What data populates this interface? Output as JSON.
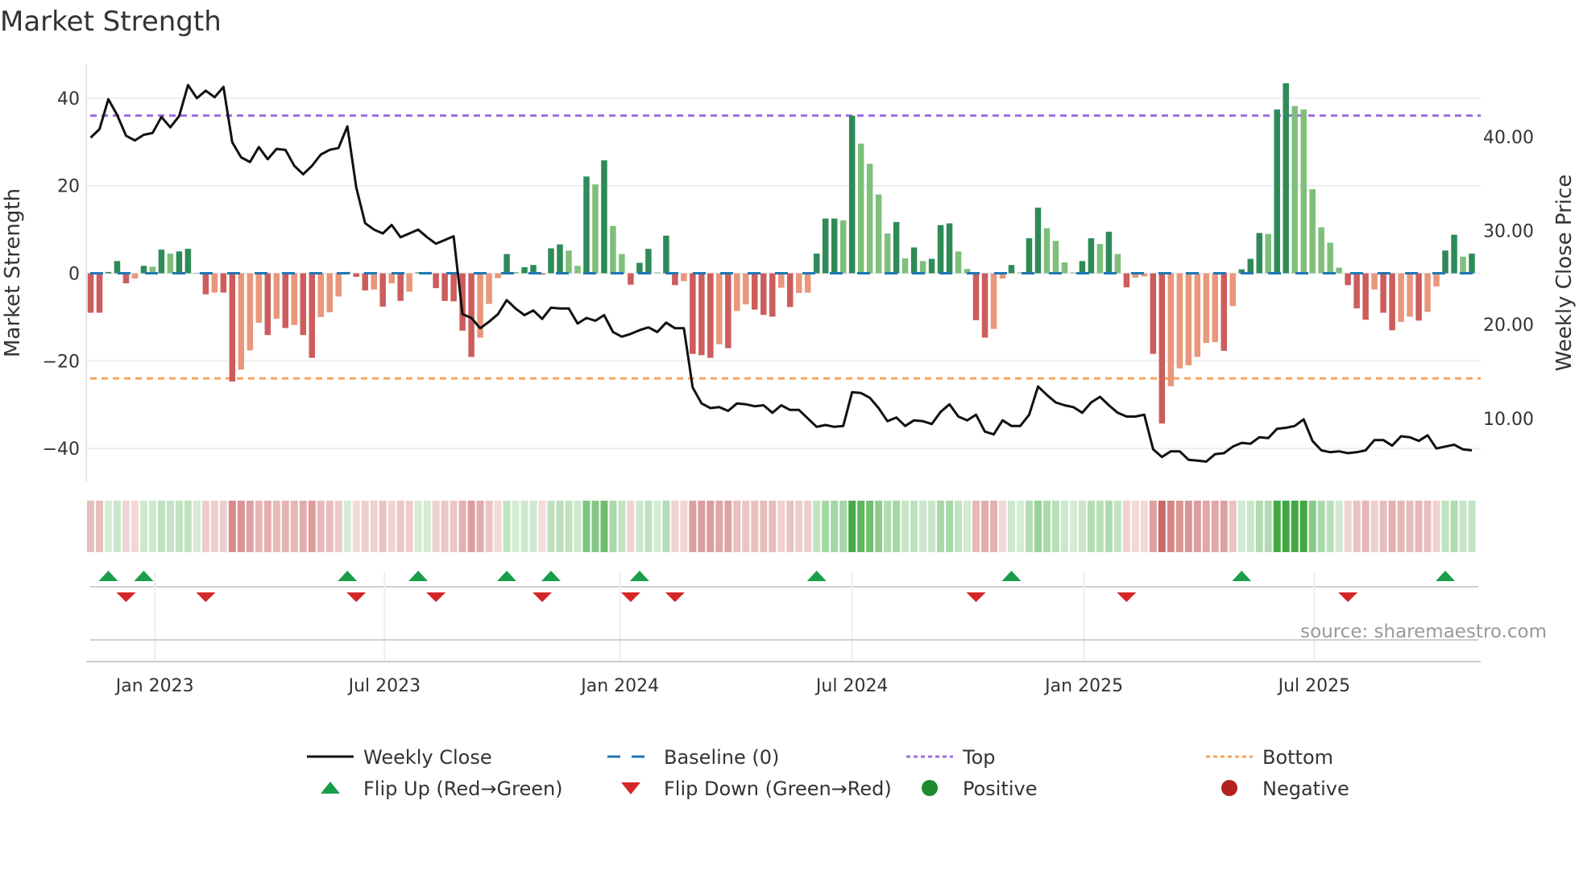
{
  "chart_data": {
    "type": "bar",
    "title": "Market Strength",
    "ylabel": "Market Strength",
    "y2label": "Weekly Close Price",
    "ylim": [
      -47.5,
      47.7
    ],
    "y2lim": [
      3.3,
      47.7
    ],
    "xlim": [
      -0.5,
      157
    ],
    "grid": true,
    "legend_position": "bottom",
    "y_ticks": [
      40,
      20,
      0,
      -20,
      -40
    ],
    "y_tick_labels": [
      "40",
      "20",
      "0",
      "−20",
      "−40"
    ],
    "y2_ticks": [
      40,
      30,
      20,
      10
    ],
    "y2_tick_labels": [
      "40.00",
      "30.00",
      "20.00",
      "10.00"
    ],
    "x_ticks_week_index": [
      7.25,
      33.2,
      59.8,
      86,
      112.2,
      138.2
    ],
    "x_tick_labels": [
      "Jan 2023",
      "Jul 2023",
      "Jan 2024",
      "Jul 2024",
      "Jan 2025",
      "Jul 2025"
    ],
    "top_level": 36,
    "bottom_level": -24,
    "baseline": 0,
    "strength": [
      -9,
      -9,
      0.3,
      2.8,
      -2.3,
      -1.2,
      1.7,
      1.5,
      5.4,
      4.5,
      5,
      5.6,
      0,
      -4.8,
      -4.4,
      -4.4,
      -24.7,
      -22,
      -17.6,
      -11.3,
      -14.1,
      -10.4,
      -12.5,
      -11.8,
      -14.1,
      -19.3,
      -10,
      -8.9,
      -5.3,
      0.3,
      -0.8,
      -3.9,
      -3.7,
      -7.6,
      -2.3,
      -6.3,
      -4.2,
      0.2,
      0.3,
      -3.4,
      -6.3,
      -6.4,
      -13.1,
      -19.1,
      -14.7,
      -7,
      -1.1,
      4.4,
      0.3,
      1.4,
      1.9,
      -0.3,
      5.7,
      6.6,
      5.2,
      1.7,
      22.1,
      20.3,
      25.8,
      10.8,
      4.4,
      -2.6,
      2.4,
      5.6,
      0.2,
      8.6,
      -2.7,
      -1.8,
      -18.4,
      -18.7,
      -19.3,
      -16.2,
      -17.1,
      -8.6,
      -7.1,
      -8.3,
      -9.5,
      -9.9,
      -3.3,
      -7.7,
      -4.5,
      -4.4,
      4.5,
      12.5,
      12.5,
      12.1,
      36,
      29.6,
      25,
      18,
      9.1,
      11.7,
      3.4,
      5.9,
      2.8,
      3.3,
      11,
      11.4,
      5,
      1,
      -10.7,
      -14.7,
      -12.7,
      -1.2,
      1.9,
      0.2,
      8,
      15,
      10.3,
      7.4,
      2.5,
      0.2,
      2.8,
      8,
      6.7,
      9.5,
      4.4,
      -3.2,
      -1,
      -0.7,
      -18.4,
      -34.3,
      -25.8,
      -21.7,
      -21,
      -19.1,
      -15.9,
      -15.7,
      -17.7,
      -7.5,
      0.9,
      3.3,
      9.2,
      9,
      37.4,
      43.4,
      38.2,
      37.4,
      19.2,
      10.5,
      7,
      1.3,
      -2.7,
      -8,
      -10.6,
      -3.7,
      -9,
      -13,
      -11.1,
      -9.9,
      -10.8,
      -8.8,
      -3,
      5.2,
      8.8,
      3.8,
      4.5
    ],
    "weekly_close": [
      39.9,
      40.8,
      44.0,
      42.3,
      40.1,
      39.6,
      40.2,
      40.4,
      42.1,
      41.0,
      42.2,
      45.5,
      44.1,
      44.9,
      44.2,
      45.3,
      39.4,
      37.8,
      37.3,
      38.9,
      37.6,
      38.7,
      38.6,
      36.9,
      36.0,
      36.9,
      38.1,
      38.6,
      38.8,
      41.1,
      34.6,
      30.8,
      30.1,
      29.7,
      30.6,
      29.3,
      29.7,
      30.1,
      29.3,
      28.6,
      29.0,
      29.4,
      21.1,
      20.7,
      19.6,
      20.3,
      21.1,
      22.6,
      21.7,
      21.0,
      21.5,
      20.6,
      21.8,
      21.7,
      21.7,
      20.1,
      20.7,
      20.4,
      21.0,
      19.2,
      18.7,
      19.0,
      19.4,
      19.7,
      19.2,
      20.2,
      19.6,
      19.6,
      13.3,
      11.6,
      11.1,
      11.2,
      10.8,
      11.6,
      11.5,
      11.3,
      11.4,
      10.6,
      11.4,
      10.9,
      10.9,
      10.0,
      9.1,
      9.3,
      9.1,
      9.2,
      12.8,
      12.7,
      12.2,
      11.1,
      9.7,
      10.1,
      9.2,
      9.8,
      9.7,
      9.4,
      10.7,
      11.5,
      10.2,
      9.8,
      10.4,
      8.6,
      8.3,
      9.8,
      9.2,
      9.2,
      10.4,
      13.4,
      12.5,
      11.7,
      11.4,
      11.2,
      10.6,
      11.7,
      12.3,
      11.4,
      10.6,
      10.2,
      10.2,
      10.4,
      6.7,
      5.9,
      6.5,
      6.5,
      5.6,
      5.5,
      5.4,
      6.2,
      6.3,
      7.0,
      7.4,
      7.3,
      8.0,
      7.9,
      8.9,
      9.0,
      9.2,
      9.9,
      7.6,
      6.6,
      6.4,
      6.5,
      6.3,
      6.4,
      6.6,
      7.7,
      7.7,
      7.1,
      8.1,
      8.0,
      7.6,
      8.2,
      6.8,
      7.0,
      7.2,
      6.7,
      6.6
    ],
    "flip_up_week_index": [
      2,
      6,
      29,
      37,
      47,
      52,
      62,
      82,
      104,
      130,
      153
    ],
    "flip_down_week_index": [
      4,
      13,
      30,
      39,
      51,
      61,
      66,
      100,
      117,
      142
    ],
    "legend": [
      {
        "label": "Weekly Close",
        "kind": "line"
      },
      {
        "label": "Baseline (0)",
        "kind": "dash"
      },
      {
        "label": "Top",
        "kind": "dot-purple"
      },
      {
        "label": "Bottom",
        "kind": "dot-orange"
      },
      {
        "label": "Flip Up (Red→Green)",
        "kind": "tri-up"
      },
      {
        "label": "Flip Down (Green→Red)",
        "kind": "tri-down"
      },
      {
        "label": "Positive",
        "kind": "circle-green"
      },
      {
        "label": "Negative",
        "kind": "circle-red"
      }
    ],
    "source": "source: sharemaestro.com"
  },
  "colors": {
    "pos_dark": "#2e8b57",
    "pos_light": "#7fbf7b",
    "neg_dark": "#cd5c5c",
    "neg_light": "#e9967a",
    "baseline": "#1f77b4",
    "top": "#9b6fe0",
    "bottom": "#f4a460",
    "close": "#111111",
    "flip_up": "#1a9e4a",
    "flip_down": "#d62728",
    "strip_pos": "#2ca02c",
    "strip_neg": "#c0504d",
    "positive": "#1f8b2c",
    "negative": "#b22222"
  }
}
